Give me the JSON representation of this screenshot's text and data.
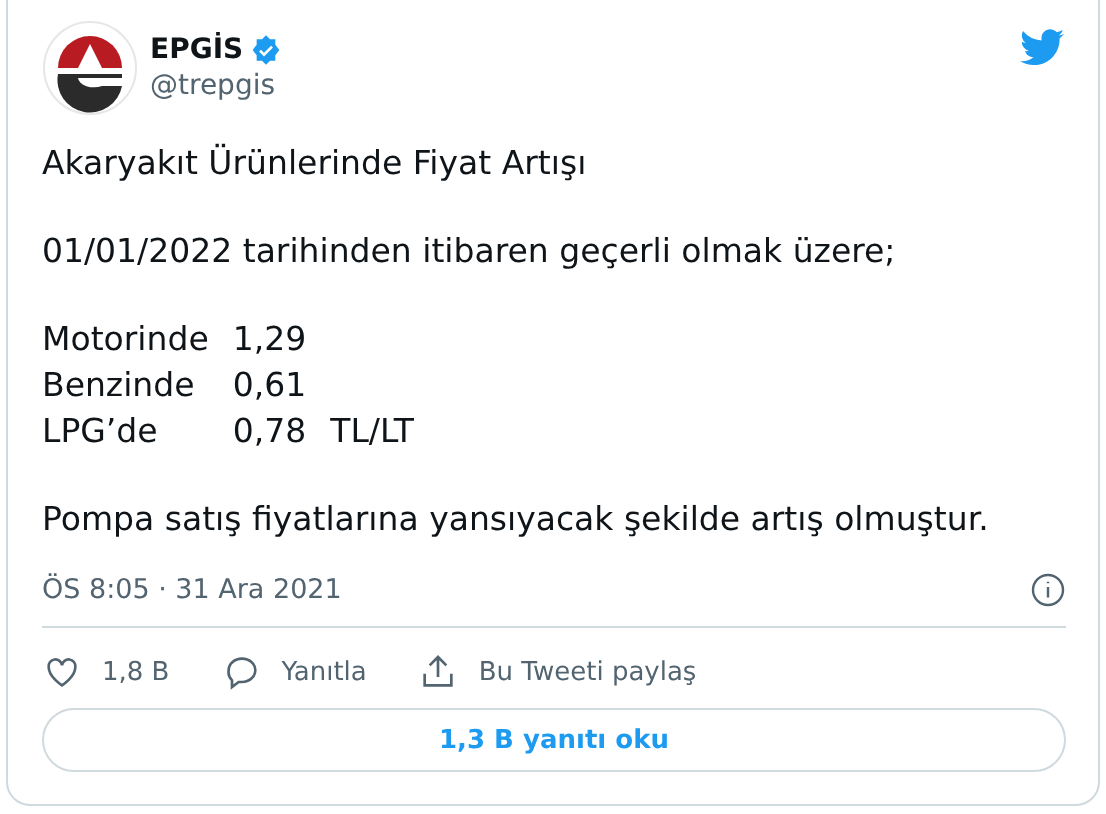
{
  "author": {
    "name": "EPGİS",
    "handle": "@trepgis",
    "verified": true
  },
  "title": "Akaryakıt Ürünlerinde Fiyat Artışı",
  "intro": "01/01/2022 tarihinden itibaren geçerli olmak üzere;",
  "prices": [
    {
      "label": "Motorinde",
      "value": "1,29"
    },
    {
      "label": "Benzinde",
      "value": "0,61"
    },
    {
      "label": "LPG’de",
      "value": "0,78",
      "unit": "TL/LT"
    }
  ],
  "closing": "Pompa satış fiyatlarına yansıyacak şekilde artış olmuştur.",
  "timestamp": "ÖS 8:05 · 31 Ara 2021",
  "actions": [
    {
      "kind": "like",
      "label": "1,8 B"
    },
    {
      "kind": "reply",
      "label": "Yanıtla"
    },
    {
      "kind": "share",
      "label": "Bu Tweeti paylaş"
    }
  ],
  "replies_button": "1,3 B yanıtı oku"
}
